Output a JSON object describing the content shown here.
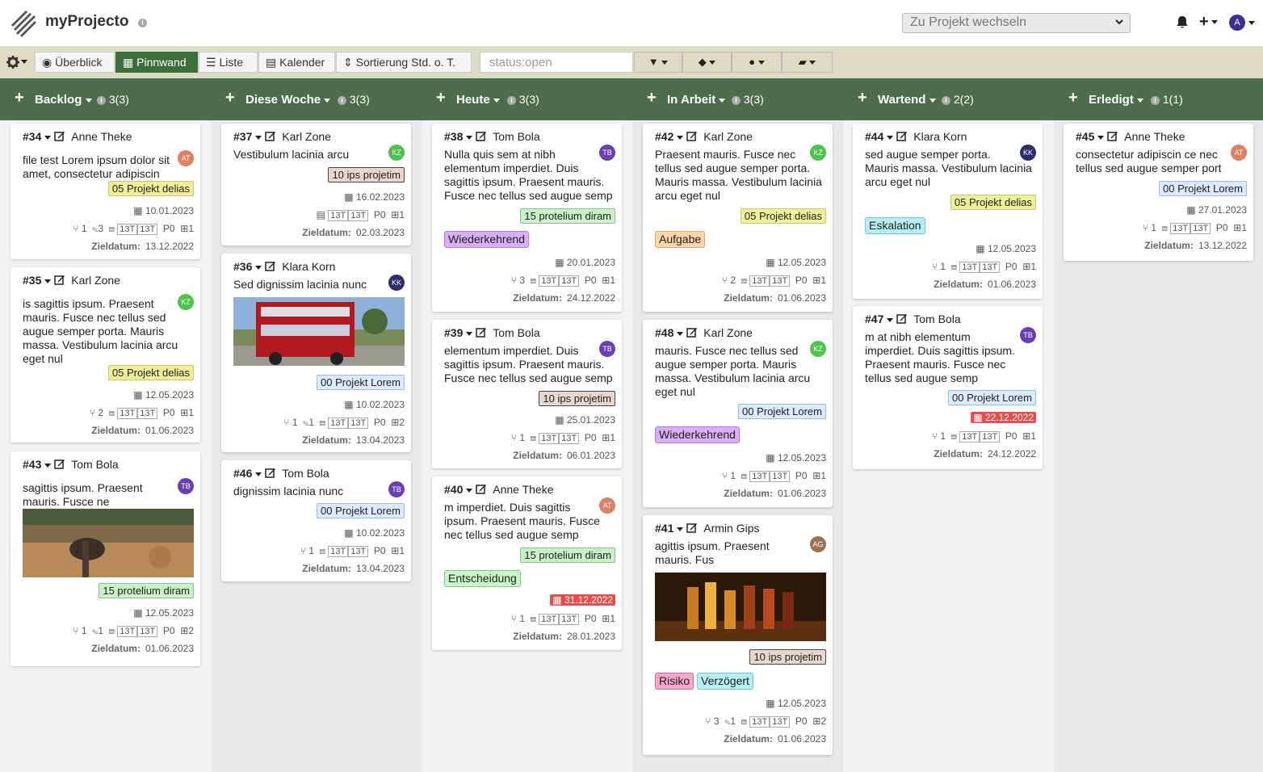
{
  "app": {
    "title": "myProjecto",
    "info": "i"
  },
  "project_switch": {
    "placeholder": "Zu Projekt wechseln"
  },
  "user": {
    "initial": "A"
  },
  "toolbar": {
    "overview": "Überblick",
    "pinboard": "Pinnwand",
    "list": "Liste",
    "calendar": "Kalender",
    "sort": "Sortierung Std. o. T.",
    "search_value": "status:open"
  },
  "meta_box": "13T",
  "ziel_label": "Zieldatum:",
  "columns": [
    {
      "name": "Backlog",
      "count": "3(3)"
    },
    {
      "name": "Diese Woche",
      "count": "3(3)"
    },
    {
      "name": "Heute",
      "count": "3(3)"
    },
    {
      "name": "In Arbeit",
      "count": "3(3)"
    },
    {
      "name": "Wartend",
      "count": "2(2)"
    },
    {
      "name": "Erledigt",
      "count": "1(1)"
    }
  ],
  "cards": {
    "c34": {
      "id": "#34",
      "user": "Anne Theke",
      "av": "AT",
      "text": [
        "file test Lorem ipsum dolor sit",
        "amet, consectetur adipiscin"
      ],
      "tag": "05 Projekt delias",
      "date": "10.01.2023",
      "m1": "1",
      "m2": "3",
      "p": "P0",
      "sub": "1",
      "ziel": "13.12.2022"
    },
    "c35": {
      "id": "#35",
      "user": "Karl Zone",
      "av": "KZ",
      "text": [
        "is sagittis ipsum. Praesent",
        "mauris. Fusce nec tellus sed",
        "augue semper porta. Mauris",
        "massa. Vestibulum lacinia arcu",
        "eget nul"
      ],
      "tag": "05 Projekt delias",
      "date": "12.05.2023",
      "m1": "2",
      "p": "P0",
      "sub": "1",
      "ziel": "01.06.2023"
    },
    "c43": {
      "id": "#43",
      "user": "Tom Bola",
      "av": "TB",
      "text": [
        "sagittis ipsum. Praesent",
        "mauris. Fusce ne"
      ],
      "tag": "15 protelium diram",
      "date": "12.05.2023",
      "m1": "1",
      "m2": "1",
      "p": "P0",
      "sub": "2",
      "ziel": "01.06.2023"
    },
    "c37": {
      "id": "#37",
      "user": "Karl Zone",
      "av": "KZ",
      "text": [
        "Vestibulum lacinia arcu"
      ],
      "tag": "10 ips projetim",
      "date": "16.02.2023",
      "p": "P0",
      "sub": "1",
      "ziel": "02.03.2023"
    },
    "c36": {
      "id": "#36",
      "user": "Klara Korn",
      "av": "KK",
      "text": [
        "Sed dignissim lacinia nunc"
      ],
      "tag": "00 Projekt Lorem",
      "date": "10.02.2023",
      "m1": "1",
      "m2": "1",
      "p": "P0",
      "sub": "2",
      "ziel": "13.04.2023"
    },
    "c46": {
      "id": "#46",
      "user": "Tom Bola",
      "av": "TB",
      "text": [
        "dignissim lacinia nunc"
      ],
      "tag": "00 Projekt Lorem",
      "date": "10.02.2023",
      "m1": "1",
      "p": "P0",
      "sub": "1",
      "ziel": "13.04.2023"
    },
    "c38": {
      "id": "#38",
      "user": "Tom Bola",
      "av": "TB",
      "text": [
        "Nulla quis sem at nibh",
        "elementum imperdiet. Duis",
        "sagittis ipsum. Praesent mauris.",
        "Fusce nec tellus sed augue semp"
      ],
      "tag": "15 protelium diram",
      "label": "Wiederkehrend",
      "date": "20.01.2023",
      "m1": "3",
      "p": "P0",
      "sub": "1",
      "ziel": "24.12.2022"
    },
    "c39": {
      "id": "#39",
      "user": "Tom Bola",
      "av": "TB",
      "text": [
        "elementum imperdiet. Duis",
        "sagittis ipsum. Praesent mauris.",
        "Fusce nec tellus sed augue semp"
      ],
      "tag": "10 ips projetim",
      "date": "25.01.2023",
      "m1": "1",
      "p": "P0",
      "sub": "1",
      "ziel": "06.01.2023"
    },
    "c40": {
      "id": "#40",
      "user": "Anne Theke",
      "av": "AT",
      "text": [
        "m imperdiet. Duis sagittis",
        "ipsum. Praesent mauris. Fusce",
        "nec tellus sed augue semp"
      ],
      "tag": "15 protelium diram",
      "label": "Entscheidung",
      "date": "31.12.2022",
      "m1": "1",
      "p": "P0",
      "sub": "1",
      "ziel": "28.01.2023"
    },
    "c42": {
      "id": "#42",
      "user": "Karl Zone",
      "av": "KZ",
      "text": [
        "Praesent mauris. Fusce nec",
        "tellus sed augue semper porta.",
        "Mauris massa. Vestibulum lacinia",
        "arcu eget nul"
      ],
      "tag": "05 Projekt delias",
      "label": "Aufgabe",
      "date": "12.05.2023",
      "m1": "2",
      "p": "P0",
      "sub": "1",
      "ziel": "01.06.2023"
    },
    "c48": {
      "id": "#48",
      "user": "Karl Zone",
      "av": "KZ",
      "text": [
        "mauris. Fusce nec tellus sed",
        "augue semper porta. Mauris",
        "massa. Vestibulum lacinia arcu",
        "eget nul"
      ],
      "tag": "00 Projekt Lorem",
      "label": "Wiederkehrend",
      "date": "12.05.2023",
      "m1": "1",
      "p": "P0",
      "sub": "1",
      "ziel": "01.06.2023"
    },
    "c41": {
      "id": "#41",
      "user": "Armin Gips",
      "av": "AG",
      "text": [
        "agittis ipsum. Praesent",
        "mauris. Fus"
      ],
      "tag": "10 ips projetim",
      "label": "Risiko",
      "label2": "Verzögert",
      "date": "12.05.2023",
      "m1": "3",
      "m2": "1",
      "p": "P0",
      "sub": "2",
      "ziel": "01.06.2023"
    },
    "c44": {
      "id": "#44",
      "user": "Klara Korn",
      "av": "KK",
      "text": [
        "sed augue semper porta.",
        "Mauris massa. Vestibulum lacinia",
        "arcu eget nul"
      ],
      "tag": "05 Projekt delias",
      "label": "Eskalation",
      "date": "12.05.2023",
      "m1": "1",
      "p": "P0",
      "sub": "1",
      "ziel": "01.06.2023"
    },
    "c47": {
      "id": "#47",
      "user": "Tom Bola",
      "av": "TB",
      "text": [
        "m at nibh elementum",
        "imperdiet. Duis sagittis ipsum.",
        "Praesent mauris. Fusce nec",
        "tellus sed augue semp"
      ],
      "tag": "00 Projekt Lorem",
      "date": "22.12.2022",
      "m1": "1",
      "p": "P0",
      "sub": "1",
      "ziel": "24.12.2022"
    },
    "c45": {
      "id": "#45",
      "user": "Anne Theke",
      "av": "AT",
      "text": [
        "consectetur adipiscin ce nec",
        "tellus sed augue semper port"
      ],
      "tag": "00 Projekt Lorem",
      "date": "27.01.2023",
      "m1": "1",
      "p": "P0",
      "sub": "1",
      "ziel": "13.12.2022"
    }
  }
}
